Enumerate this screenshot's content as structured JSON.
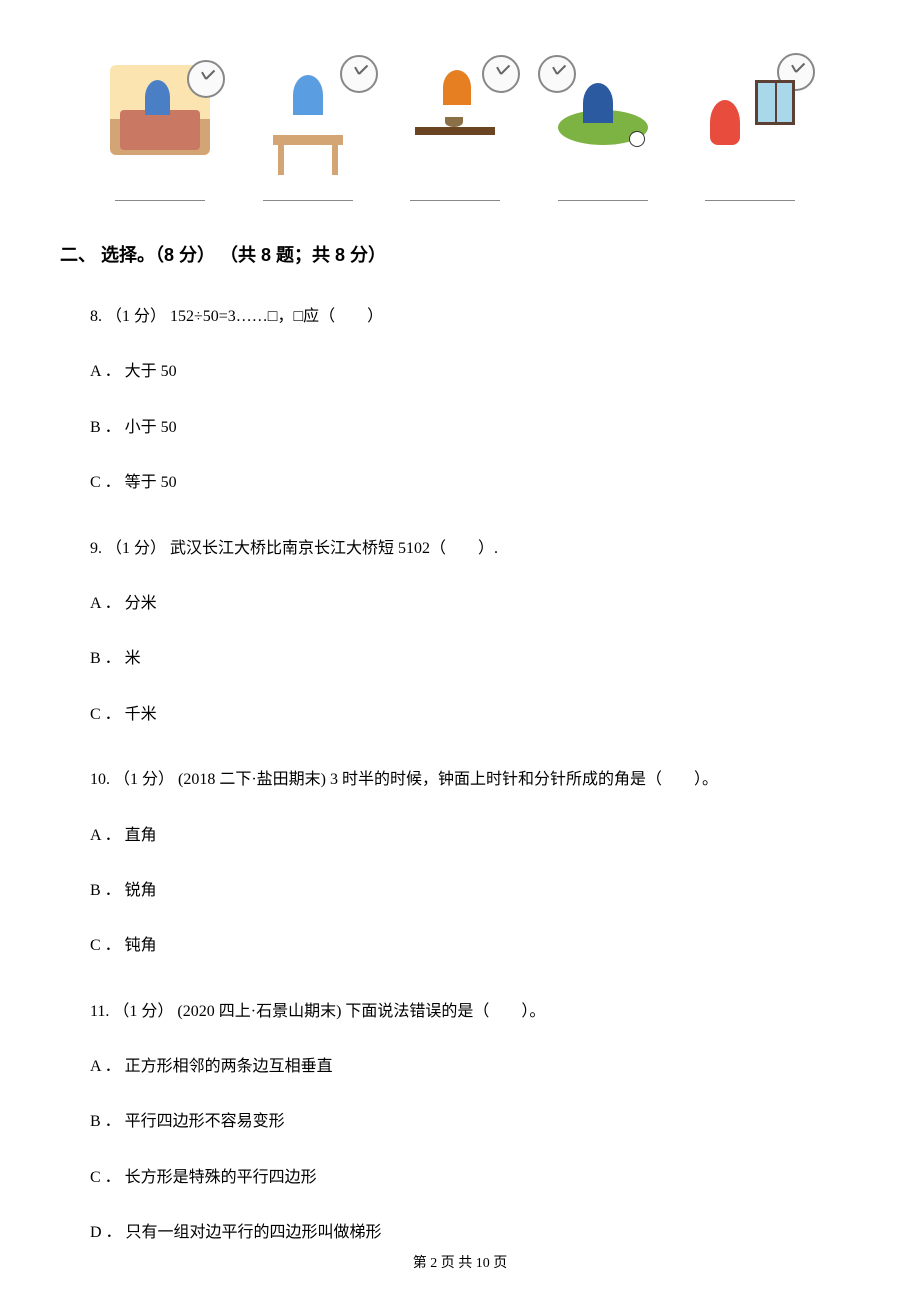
{
  "section": {
    "heading": "二、 选择。（8 分） （共 8 题；共 8 分）"
  },
  "questions": {
    "q8": {
      "text": "8. （1 分） 152÷50=3……□，□应（　　）",
      "optA": "A ． 大于 50",
      "optB": "B ． 小于 50",
      "optC": "C ． 等于 50"
    },
    "q9": {
      "text": "9. （1 分） 武汉长江大桥比南京长江大桥短 5102（　　）.",
      "optA": "A ． 分米",
      "optB": "B ． 米",
      "optC": "C ． 千米"
    },
    "q10": {
      "text": "10. （1 分） (2018 二下·盐田期末) 3 时半的时候，钟面上时针和分针所成的角是（　　）。",
      "optA": "A ． 直角",
      "optB": "B ． 锐角",
      "optC": "C ． 钝角"
    },
    "q11": {
      "text": "11. （1 分） (2020 四上·石景山期末) 下面说法错误的是（　　）。",
      "optA": "A ． 正方形相邻的两条边互相垂直",
      "optB": "B ． 平行四边形不容易变形",
      "optC": "C ． 长方形是特殊的平行四边形",
      "optD": "D ． 只有一组对边平行的四边形叫做梯形"
    }
  },
  "footer": {
    "text": "第 2 页 共 10 页"
  }
}
